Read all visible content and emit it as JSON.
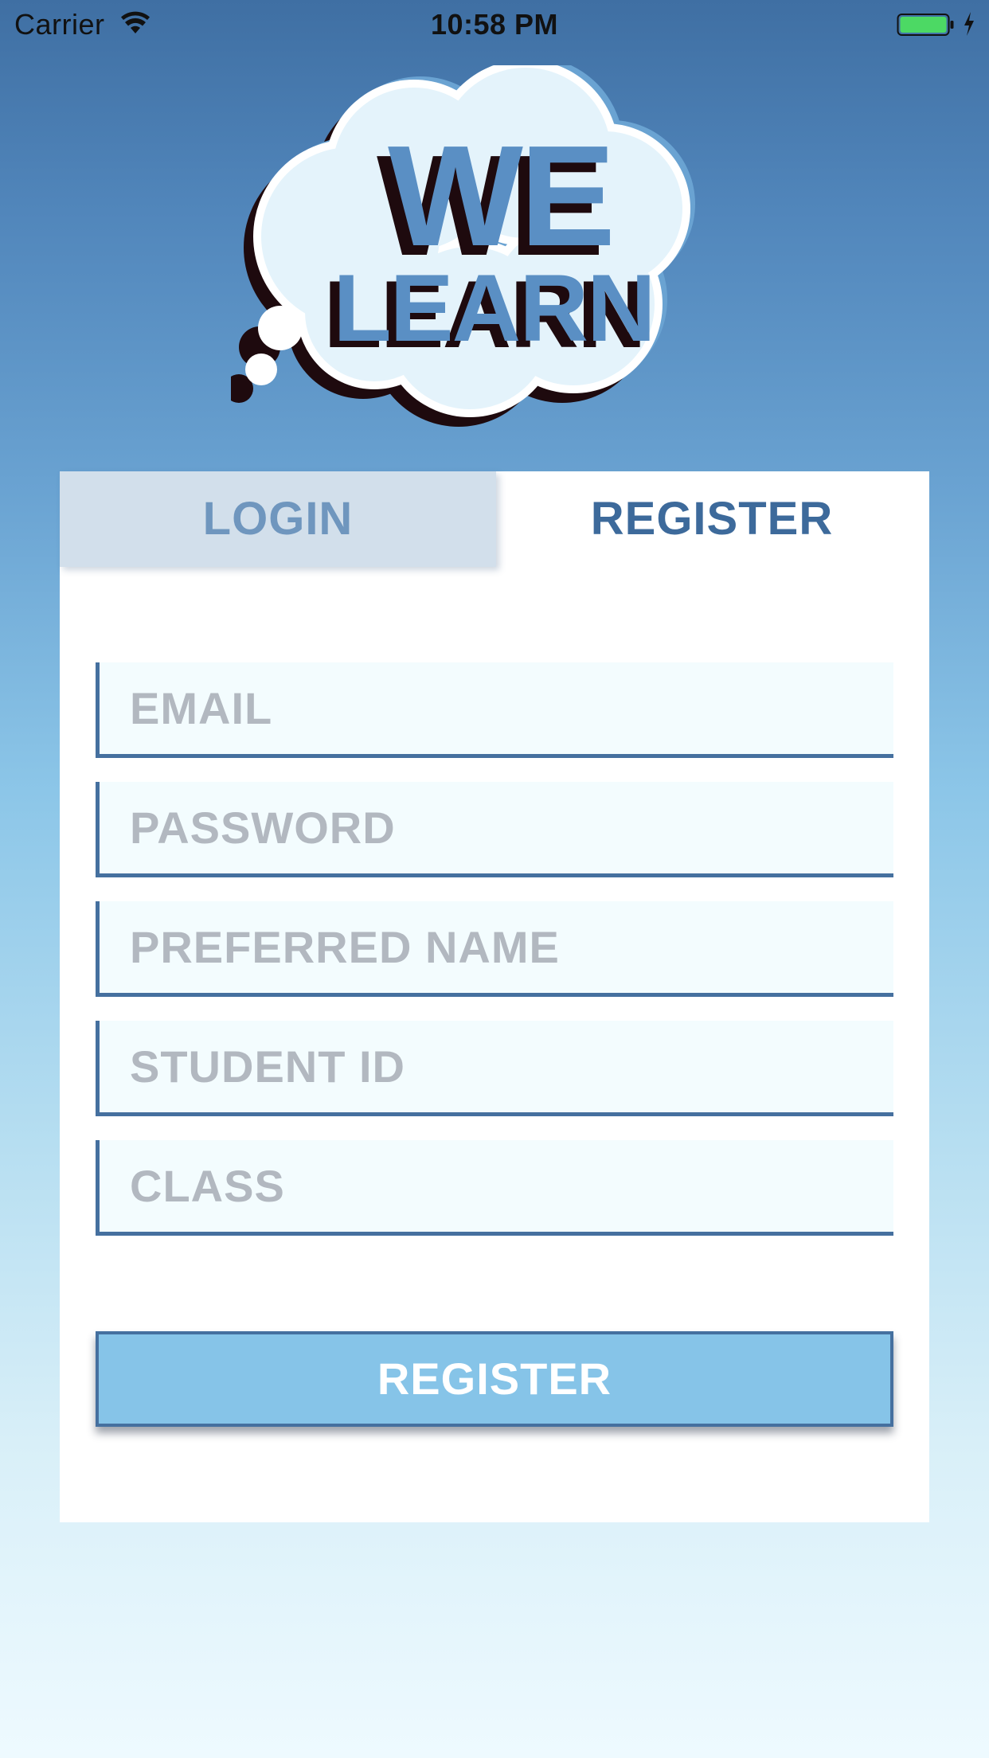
{
  "status_bar": {
    "carrier": "Carrier",
    "time": "10:58 PM",
    "battery_color": "#4cd964",
    "wifi_icon": "wifi-icon",
    "battery_icon": "battery-icon",
    "charging_icon": "charging-bolt-icon"
  },
  "logo": {
    "line1": "WE",
    "line2": "LEARN",
    "shape": "thought-cloud"
  },
  "tabs": {
    "login": "LOGIN",
    "register": "REGISTER",
    "active": "register"
  },
  "form": {
    "email": {
      "placeholder": "EMAIL",
      "value": ""
    },
    "password": {
      "placeholder": "PASSWORD",
      "value": ""
    },
    "preferred_name": {
      "placeholder": "PREFERRED NAME",
      "value": ""
    },
    "student_id": {
      "placeholder": "STUDENT ID",
      "value": ""
    },
    "class": {
      "placeholder": "CLASS",
      "value": ""
    },
    "submit_label": "REGISTER"
  },
  "colors": {
    "primary": "#3d6a9b",
    "button": "#86c4e8",
    "placeholder": "#b2b8c0",
    "inactive_tab": "#d2dfeb"
  }
}
